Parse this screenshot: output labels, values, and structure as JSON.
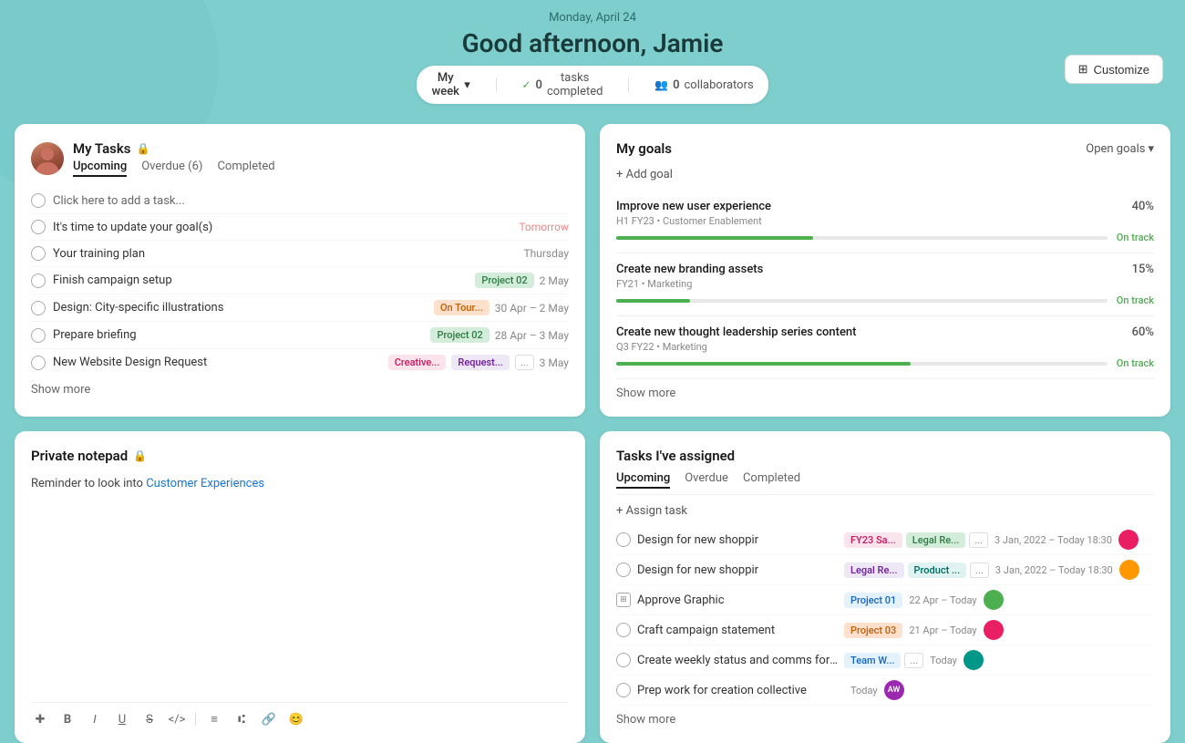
{
  "header": {
    "date": "Monday, April 24",
    "greeting": "Good afternoon, Jamie",
    "week_selector": "My week",
    "tasks_completed_label": "tasks completed",
    "tasks_completed_count": "0",
    "collaborators_label": "collaborators",
    "collaborators_count": "0",
    "customize_label": "Customize"
  },
  "my_tasks": {
    "title": "My Tasks",
    "tabs": [
      "Upcoming",
      "Overdue (6)",
      "Completed"
    ],
    "active_tab": 0,
    "add_task_placeholder": "Click here to add a task...",
    "tasks": [
      {
        "name": "It's time to update your goal(s)",
        "date": "Tomorrow",
        "date_class": "tomorrow",
        "tags": []
      },
      {
        "name": "Your training plan",
        "date": "Thursday",
        "date_class": "normal",
        "tags": []
      },
      {
        "name": "Finish campaign setup",
        "date": "2 May",
        "date_class": "normal",
        "tags": [
          {
            "label": "Project 02",
            "class": "tag-green"
          }
        ]
      },
      {
        "name": "Design: City-specific illustrations",
        "date": "30 Apr – 2 May",
        "date_class": "normal",
        "tags": [
          {
            "label": "On Tour...",
            "class": "tag-orange"
          }
        ]
      },
      {
        "name": "Prepare briefing",
        "date": "28 Apr – 3 May",
        "date_class": "normal",
        "tags": [
          {
            "label": "Project 02",
            "class": "tag-green"
          }
        ]
      },
      {
        "name": "New Website Design Request",
        "date": "3 May",
        "date_class": "normal",
        "tags": [
          {
            "label": "Creative...",
            "class": "tag-pink"
          },
          {
            "label": "Request...",
            "class": "tag-purple"
          }
        ]
      }
    ],
    "show_more_label": "Show more"
  },
  "my_goals": {
    "title": "My goals",
    "open_goals_label": "Open goals",
    "add_goal_label": "+ Add goal",
    "goals": [
      {
        "name": "Improve new user experience",
        "period": "H1 FY23",
        "category": "Customer Enablement",
        "pct": 40,
        "pct_label": "40%",
        "status": "On track",
        "bar_color": "#4caf50"
      },
      {
        "name": "Create new branding assets",
        "period": "FY21",
        "category": "Marketing",
        "pct": 15,
        "pct_label": "15%",
        "status": "On track",
        "bar_color": "#4caf50"
      },
      {
        "name": "Create new thought leadership series content",
        "period": "Q3 FY22",
        "category": "Marketing",
        "pct": 60,
        "pct_label": "60%",
        "status": "On track",
        "bar_color": "#4caf50"
      }
    ],
    "show_more_label": "Show more"
  },
  "private_notepad": {
    "title": "Private notepad",
    "content_prefix": "Reminder to look into ",
    "content_link": "Customer Experiences",
    "toolbar": [
      "✚",
      "B",
      "I",
      "U",
      "S",
      "</>",
      "≡",
      "⑆",
      "🔗",
      "😊"
    ]
  },
  "tasks_assigned": {
    "title": "Tasks I've assigned",
    "tabs": [
      "Upcoming",
      "Overdue",
      "Completed"
    ],
    "active_tab": 0,
    "assign_task_label": "+ Assign task",
    "tasks": [
      {
        "name": "Design for new shoppir",
        "tags": [
          {
            "label": "FY23 Sa...",
            "class": "tag-pink"
          },
          {
            "label": "Legal Re...",
            "class": "tag-green"
          }
        ],
        "more": "...",
        "date": "3 Jan, 2022 – Today 18:30",
        "avatar_class": "dot-pink",
        "avatar_initials": ""
      },
      {
        "name": "Design for new shoppir",
        "tags": [
          {
            "label": "Legal Re...",
            "class": "tag-purple"
          },
          {
            "label": "Product ...",
            "class": "tag-teal"
          }
        ],
        "more": "...",
        "date": "3 Jan, 2022 – Today 18:30",
        "avatar_class": "dot-orange",
        "avatar_initials": ""
      },
      {
        "name": "Approve Graphic",
        "tags": [
          {
            "label": "Project 01",
            "class": "tag-blue"
          }
        ],
        "more": "",
        "date": "22 Apr – Today",
        "avatar_class": "dot-green",
        "avatar_initials": "",
        "icon": "milestone"
      },
      {
        "name": "Craft campaign statement",
        "tags": [
          {
            "label": "Project 03",
            "class": "tag-orange"
          }
        ],
        "more": "",
        "date": "21 Apr – Today",
        "avatar_class": "dot-pink",
        "avatar_initials": ""
      },
      {
        "name": "Create weekly status and comms for stakeholders",
        "tags": [
          {
            "label": "Team W...",
            "class": "tag-blue"
          }
        ],
        "more": "...",
        "date": "Today",
        "avatar_class": "dot-teal",
        "avatar_initials": ""
      },
      {
        "name": "Prep work for creation collective",
        "tags": [],
        "more": "",
        "date": "Today",
        "avatar_class": "dot-initials",
        "avatar_initials": "AW"
      }
    ],
    "show_more_label": "Show more"
  }
}
